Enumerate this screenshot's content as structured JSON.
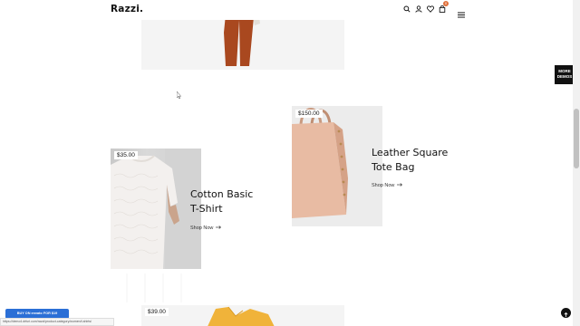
{
  "header": {
    "logo": "Razzi.",
    "cart_count": "0"
  },
  "more_demos": {
    "line1": "MORE",
    "line2": "DEMOS"
  },
  "products": [
    {
      "price": "$35.00",
      "title_line1": "Cotton Basic",
      "title_line2": "T-Shirt",
      "shop_label": "Shop Now"
    },
    {
      "price": "$150.00",
      "title_line1": "Leather Square",
      "title_line2": "Tote Bag",
      "shop_label": "Shop Now"
    },
    {
      "price": "$39.00"
    }
  ],
  "envato": {
    "label": "BUY ON envato FOR $19"
  },
  "status_url": "https://demo4.drfuri.com/razzi/product-category/women/t-shirts/",
  "colors": {
    "accent": "#e0703a",
    "envato_blue": "#2b6fd6",
    "dark": "#111111"
  }
}
